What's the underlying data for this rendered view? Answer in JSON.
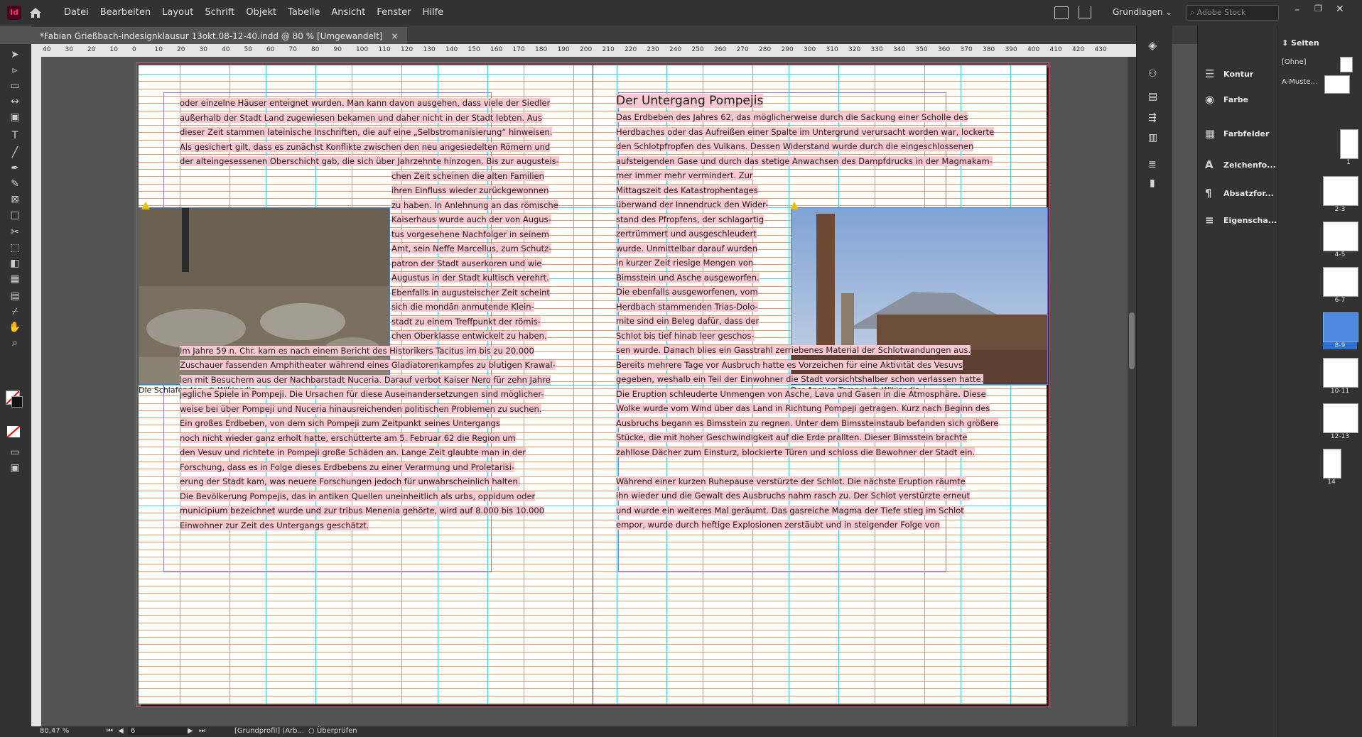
{
  "menubar": {
    "app_icon": "Id",
    "items": [
      "Datei",
      "Bearbeiten",
      "Layout",
      "Schrift",
      "Objekt",
      "Tabelle",
      "Ansicht",
      "Fenster",
      "Hilfe"
    ],
    "workspace": "Grundlagen",
    "search_placeholder": "Adobe Stock"
  },
  "doc_tab": {
    "title": "*Fabian Grießbach-indesignklausur 13okt.08-12-40.indd @ 80 % [Umgewandelt]",
    "close": "×"
  },
  "ruler_marks": [
    "40",
    "30",
    "20",
    "10",
    "0",
    "10",
    "20",
    "30",
    "40",
    "50",
    "60",
    "70",
    "80",
    "90",
    "100",
    "110",
    "120",
    "130",
    "140",
    "150",
    "160",
    "170",
    "180",
    "190",
    "200",
    "210",
    "220",
    "230",
    "240",
    "250",
    "260",
    "270",
    "280",
    "290",
    "300",
    "310",
    "320",
    "330",
    "340",
    "350",
    "360",
    "370",
    "380",
    "390",
    "400",
    "410",
    "420",
    "430"
  ],
  "left_page": {
    "top_lines": [
      "oder einzelne Häuser enteignet wurden. Man kann davon ausgehen, dass viele der Siedler",
      "außerhalb der Stadt Land zugewiesen bekamen und daher nicht in der Stadt lebten. Aus",
      "dieser Zeit stammen lateinische Inschriften, die auf eine „Selbstromanisierung“ hinweisen.",
      "Als gesichert gilt, dass es zunächst Konflikte zwischen den neu angesiedelten Römern und",
      "der alteingesessenen Oberschicht gab, die sich über Jahrzehnte hinzogen. Bis zur augusteis-"
    ],
    "wrap_lines": [
      "chen Zeit scheinen die alten Familien",
      "ihren Einfluss wieder zurückgewonnen",
      "zu haben. In Anlehnung an das römische",
      "Kaiserhaus wurde auch der von Augus-",
      "tus vorgesehene Nachfolger in seinem",
      "Amt, sein Neffe Marcellus, zum Schutz-",
      "patron der Stadt auserkoren und wie",
      "Augustus in der Stadt kultisch verehrt.",
      "Ebenfalls in augusteischer Zeit scheint",
      "sich die mondän anmutende Klein-",
      "stadt zu einem Treffpunkt der römis-",
      "chen Oberklasse entwickelt zu haben."
    ],
    "bottom_lines": [
      "Im Jahre 59 n. Chr. kam es nach einem Bericht des Historikers Tacitus im bis zu 20.000",
      "Zuschauer fassenden Amphitheater während eines Gladiatorenkampfes zu blutigen Krawal-",
      "len mit Besuchern aus der Nachbarstadt Nuceria. Darauf verbot Kaiser Nero für zehn Jahre",
      "jegliche Spiele in Pompeji. Die Ursachen für diese Auseinandersetzungen sind möglicher-",
      "weise bei über Pompeji und Nuceria hinausreichenden politischen Problemen zu suchen.",
      "Ein großes Erdbeben, von dem sich Pompeji zum Zeitpunkt seines Untergangs",
      "noch nicht wieder ganz erholt hatte, erschütterte am 5. Februar 62 die Region um",
      "den Vesuv und richtete in Pompeji große Schäden an. Lange Zeit glaubte man in der",
      "Forschung, dass es in Folge dieses Erdbebens zu einer Verarmung und Proletarisi-",
      "erung der Stadt kam, was neuere Forschungen jedoch für unwahrscheinlich halten.",
      "Die Bevölkerung Pompejis, das in antiken Quellen uneinheitlich als urbs, oppidum oder",
      "municipium bezeichnet wurde und zur tribus Menenia gehörte, wird auf 8.000 bis 10.000",
      "Einwohner zur Zeit des Untergangs geschätzt."
    ],
    "caption": "Die Schlafenden, © Wikipedia"
  },
  "right_page": {
    "heading": "Der Untergang Pompejis",
    "top_lines": [
      "Das Erdbeben des Jahres 62, das möglicherweise durch die Sackung einer Scholle des",
      "Herdbaches oder das Aufreißen einer Spalte im Untergrund verursacht worden war, lockerte",
      "den Schlotpfropfen des Vulkans. Dessen Widerstand wurde durch die eingeschlossenen",
      "aufsteigenden Gase und durch das stetige Anwachsen des Dampfdrucks in der Magmakam-"
    ],
    "wrap_lines": [
      "mer immer mehr vermindert. Zur",
      "Mittagszeit des Katastrophentages",
      "überwand der Innendruck den Wider-",
      "stand des Pfropfens, der schlagartig",
      "zertrümmert und ausgeschleudert",
      "wurde. Unmittelbar darauf wurden",
      "in kurzer Zeit riesige Mengen von",
      "Bimsstein und Asche ausgeworfen.",
      "Die ebenfalls ausgeworfenen, vom",
      "Herdbach stammenden Trias-Dolo-",
      "mite sind ein Beleg dafür, dass der",
      "Schlot bis tief hinab leer geschos-"
    ],
    "bottom_lines": [
      "sen wurde. Danach blies ein Gasstrahl zerriebenes Material der Schlotwandungen aus.",
      "Bereits mehrere Tage vor Ausbruch hatte es Vorzeichen für eine Aktivität des Vesuvs",
      "gegeben, weshalb ein Teil der Einwohner die Stadt vorsichtshalber schon verlassen hatte.",
      "Die Eruption schleuderte Unmengen von Asche, Lava und Gasen in die Atmosphäre. Diese",
      "Wolke wurde vom Wind über das Land in Richtung Pompeji getragen. Kurz nach Beginn des",
      "Ausbruchs begann es Bimsstein zu regnen. Unter dem Bimssteinstaub befanden sich größere",
      "Stücke, die mit hoher Geschwindigkeit auf die Erde prallten. Dieser Bimsstein brachte",
      "zahllose Dächer zum Einsturz, blockierte Türen und schloss die Bewohner der Stadt ein.",
      "",
      "Während einer kurzen Ruhepause verstürzte der Schlot. Die nächste Eruption räumte",
      "ihn wieder und die Gewalt des Ausbruchs nahm rasch zu. Der Schlot verstürzte erneut",
      "und wurde ein weiteres Mal geräumt. Das gasreiche Magma der Tiefe stieg im Schlot",
      "empor, wurde durch heftige Explosionen zerstäubt und in steigender Folge von"
    ],
    "caption": "Der Apollon-Tempel, © Wikipedia"
  },
  "panels": {
    "items": [
      "Kontur",
      "Farbe",
      "Farbfelder",
      "Zeichenfo...",
      "Absatzfor...",
      "Eigenscha..."
    ],
    "icons": [
      "stroke-icon",
      "color-icon",
      "swatches-icon",
      "character-icon",
      "paragraph-icon",
      "properties-icon"
    ]
  },
  "pages_panel": {
    "title": "Seiten",
    "none_label": "[Ohne]",
    "master_label": "A-Muste...",
    "page_labels": [
      "1",
      "2-3",
      "4-5",
      "6-7",
      "8-9",
      "10-11",
      "12-13",
      "14"
    ],
    "active": "8-9"
  },
  "status": {
    "zoom": "80,47 %",
    "page": "6",
    "profile": "[Grundprofil] (Arb...",
    "preflight": "Überprüfen"
  }
}
